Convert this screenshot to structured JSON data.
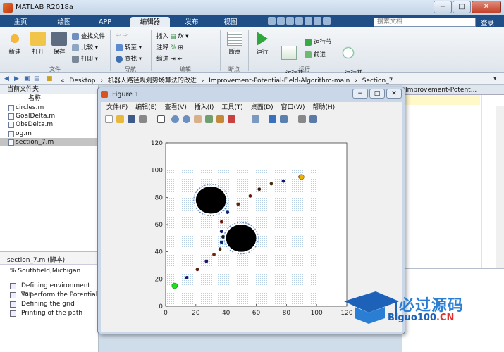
{
  "window": {
    "title": "MATLAB R2018a",
    "min": "−",
    "max": "□",
    "close": "✕"
  },
  "tabs": [
    "主页",
    "绘图",
    "APP",
    "编辑器",
    "发布",
    "视图"
  ],
  "search_placeholder": "搜索文档",
  "login": "登录",
  "ribbon": {
    "new": "新建",
    "open": "打开",
    "save": "保存",
    "find_files": "查找文件",
    "compare": "比较",
    "print": "打印",
    "goto": "转至",
    "find": "查找",
    "insert": "插入",
    "comment": "注释",
    "indent": "缩进",
    "breakpoints": "断点",
    "run": "运行",
    "run_advance": "运行并\n前进",
    "run_section": "运行节",
    "advance": "前进",
    "run_time": "运行并\n计时",
    "groups": {
      "file": "文件",
      "navigate": "导航",
      "edit": "编辑",
      "breakpoints": "断点",
      "run": "运行"
    }
  },
  "address": {
    "path": [
      "«",
      "Desktop",
      "›",
      "机器人路径规划势场算法的改进",
      "›",
      "Improvement-Potential-Field-Algorithm-main",
      "›",
      "Section_7"
    ]
  },
  "left_panel": {
    "title": "当前文件夹",
    "column": "名称",
    "files": [
      "circles.m",
      "GoalDelta.m",
      "ObsDelta.m",
      "og.m",
      "section_7.m"
    ]
  },
  "details": {
    "title": "section_7.m  (脚本)",
    "description": "% Southfield,Michigan",
    "sections": [
      "Defining environment var",
      "To perform the Potential",
      "Defining the grid",
      "Printing of the path"
    ]
  },
  "editor": {
    "tab": "Improvement-Potent..."
  },
  "figure": {
    "title": "Figure 1",
    "menus": [
      "文件(F)",
      "编辑(E)",
      "查看(V)",
      "插入(I)",
      "工具(T)",
      "桌面(D)",
      "窗口(W)",
      "帮助(H)"
    ]
  },
  "chart_data": {
    "type": "scatter",
    "xlim": [
      0,
      120
    ],
    "ylim": [
      0,
      120
    ],
    "xticks": [
      "0",
      "20",
      "40",
      "60",
      "80",
      "100",
      "120"
    ],
    "yticks": [
      "0",
      "20",
      "40",
      "60",
      "80",
      "100",
      "120"
    ],
    "obstacles": [
      {
        "x": 30,
        "y": 78,
        "r": 10
      },
      {
        "x": 50,
        "y": 50,
        "r": 10
      }
    ],
    "start": {
      "x": 6,
      "y": 15
    },
    "goal": {
      "x": 90,
      "y": 95
    },
    "path": [
      {
        "x": 14,
        "y": 21
      },
      {
        "x": 21,
        "y": 27
      },
      {
        "x": 27,
        "y": 33
      },
      {
        "x": 32,
        "y": 38
      },
      {
        "x": 36,
        "y": 42
      },
      {
        "x": 37,
        "y": 47
      },
      {
        "x": 38,
        "y": 51
      },
      {
        "x": 37,
        "y": 55
      },
      {
        "x": 37,
        "y": 62
      },
      {
        "x": 41,
        "y": 69
      },
      {
        "x": 48,
        "y": 75
      },
      {
        "x": 56,
        "y": 81
      },
      {
        "x": 62,
        "y": 86
      },
      {
        "x": 70,
        "y": 90
      },
      {
        "x": 78,
        "y": 92
      },
      {
        "x": 89,
        "y": 95
      }
    ]
  },
  "watermark": {
    "cn": "必过源码",
    "en": "Biguo100",
    "suffix": ".CN"
  }
}
